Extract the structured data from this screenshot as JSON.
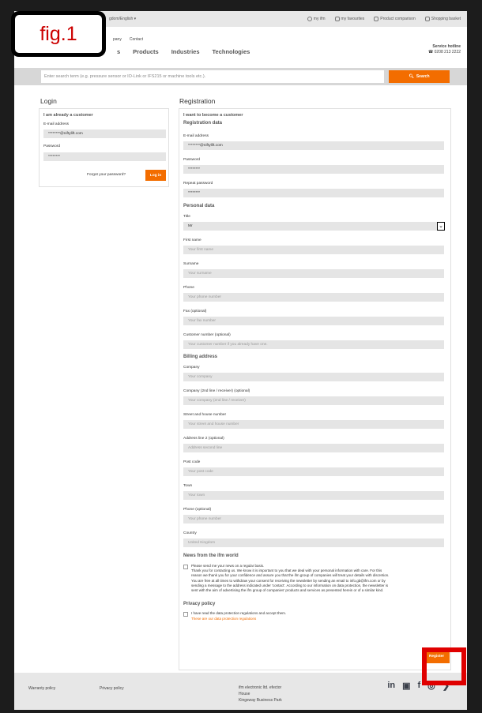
{
  "annotation": {
    "fig_label": "fig.1"
  },
  "topbar": {
    "locale": "gdom/English ▾",
    "links": [
      {
        "label": "my ifm",
        "icon": "user-icon"
      },
      {
        "label": "my favourites",
        "icon": "bookmark-icon"
      },
      {
        "label": "Product comparison",
        "icon": "compare-icon"
      },
      {
        "label": "Shopping basket",
        "icon": "cart-icon"
      }
    ]
  },
  "nav": {
    "small_links": [
      "pany",
      "Contact"
    ],
    "main": [
      "s",
      "Products",
      "Industries",
      "Technologies"
    ],
    "hotline_title": "Service hotline",
    "hotline_number": "☎ 0208 213 2222"
  },
  "search": {
    "placeholder": "Enter search term (e.g. pressure sensor or IO-Link or IFS215 or machine tools etc.).",
    "button": "Search"
  },
  "login": {
    "heading": "Login",
    "subheading": "I am already a customer",
    "email_label": "E-mail address",
    "email_value": "********@niftylift.com",
    "password_label": "Password",
    "password_value": "********",
    "forgot": "Forgot your password?",
    "login_button": "Log in"
  },
  "registration": {
    "heading": "Registration",
    "subheading": "I want to become a customer",
    "reg_data": "Registration data",
    "email_label": "E-mail address",
    "email_value": "********@niftylift.com",
    "password_label": "Password",
    "password_value": "********",
    "repeat_label": "Repeat password",
    "repeat_value": "********",
    "personal": "Personal data",
    "title_label": "Title",
    "title_value": "Mr",
    "fields": [
      {
        "label": "First name",
        "placeholder": "Your first name"
      },
      {
        "label": "Surname",
        "placeholder": "Your surname"
      },
      {
        "label": "Phone",
        "placeholder": "Your phone number"
      },
      {
        "label": "Fax (optional)",
        "placeholder": "Your fax number"
      },
      {
        "label": "Customer number (optional)",
        "placeholder": "Your customer number if you already have one."
      }
    ],
    "billing": "Billing address",
    "billing_fields": [
      {
        "label": "Company",
        "placeholder": "Your company"
      },
      {
        "label": "Company (2nd line / receiver) (optional)",
        "placeholder": "Your company (2nd line / receiver)"
      },
      {
        "label": "Street and house number",
        "placeholder": "Your street and house number"
      },
      {
        "label": "Address line 2 (optional)",
        "placeholder": "Address second line"
      },
      {
        "label": "Post code",
        "placeholder": "Your post code"
      },
      {
        "label": "Town",
        "placeholder": "Your town"
      },
      {
        "label": "Phone (optional)",
        "placeholder": "Your phone number"
      },
      {
        "label": "Country",
        "placeholder": "United Kingdom"
      }
    ],
    "news_heading": "News from the ifm world",
    "news_lines": [
      "Please send me your news on a regular basis.",
      "Thank you for contacting us. We know it is important to you that we deal with your personal information with care. For this",
      "reason we thank you for your confidence and assure you that the ifm group of companies will treat your details with discretion.",
      "You are free at all times to withdraw your consent for receiving the newsletter by sending an email to info.gb@ifm.com or by",
      "sending a message to the address indicated under 'contact'. According to our information on data protection, the newsletter is",
      "sent with the aim of advertising the ifm group of companies' products and services as presented herein or of a similar kind."
    ],
    "privacy_heading": "Privacy policy",
    "privacy_text": "I have read the data protection regulations and accept them.",
    "privacy_link": "These are our data protection regulations",
    "register_button": "Register"
  },
  "footer": {
    "links": [
      "Warranty policy",
      "Privacy policy"
    ],
    "address_lines": [
      "ifm electronic ltd. efector",
      "House",
      "Kingsway Business Park"
    ],
    "social": [
      "in",
      "▣",
      "f",
      "◎",
      "❯"
    ]
  },
  "colors": {
    "accent": "#f36d00",
    "highlight": "#e00000"
  }
}
